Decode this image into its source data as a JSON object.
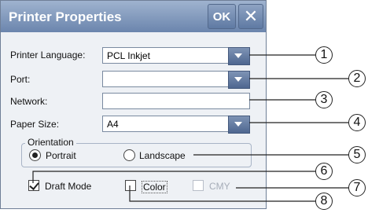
{
  "dialog": {
    "title": "Printer Properties",
    "ok_label": "OK",
    "close_icon": "close-icon"
  },
  "fields": {
    "printer_language": {
      "label": "Printer Language:",
      "value": "PCL Inkjet"
    },
    "port": {
      "label": "Port:",
      "value": ""
    },
    "network": {
      "label": "Network:",
      "value": ""
    },
    "paper_size": {
      "label": "Paper Size:",
      "value": "A4"
    }
  },
  "orientation": {
    "legend": "Orientation",
    "portrait_label": "Portrait",
    "landscape_label": "Landscape",
    "selected": "Portrait"
  },
  "options": {
    "draft_mode_label": "Draft Mode",
    "draft_mode_checked": true,
    "color_label": "Color",
    "color_checked": false,
    "cmy_label": "CMY",
    "cmy_checked": false,
    "cmy_enabled": false
  },
  "callouts": [
    "1",
    "2",
    "3",
    "4",
    "5",
    "6",
    "7",
    "8"
  ],
  "colors": {
    "titlebar": "#7f97bb",
    "dialog_bg": "#eef1f5",
    "dropdown_button": "#5f7aa3"
  }
}
